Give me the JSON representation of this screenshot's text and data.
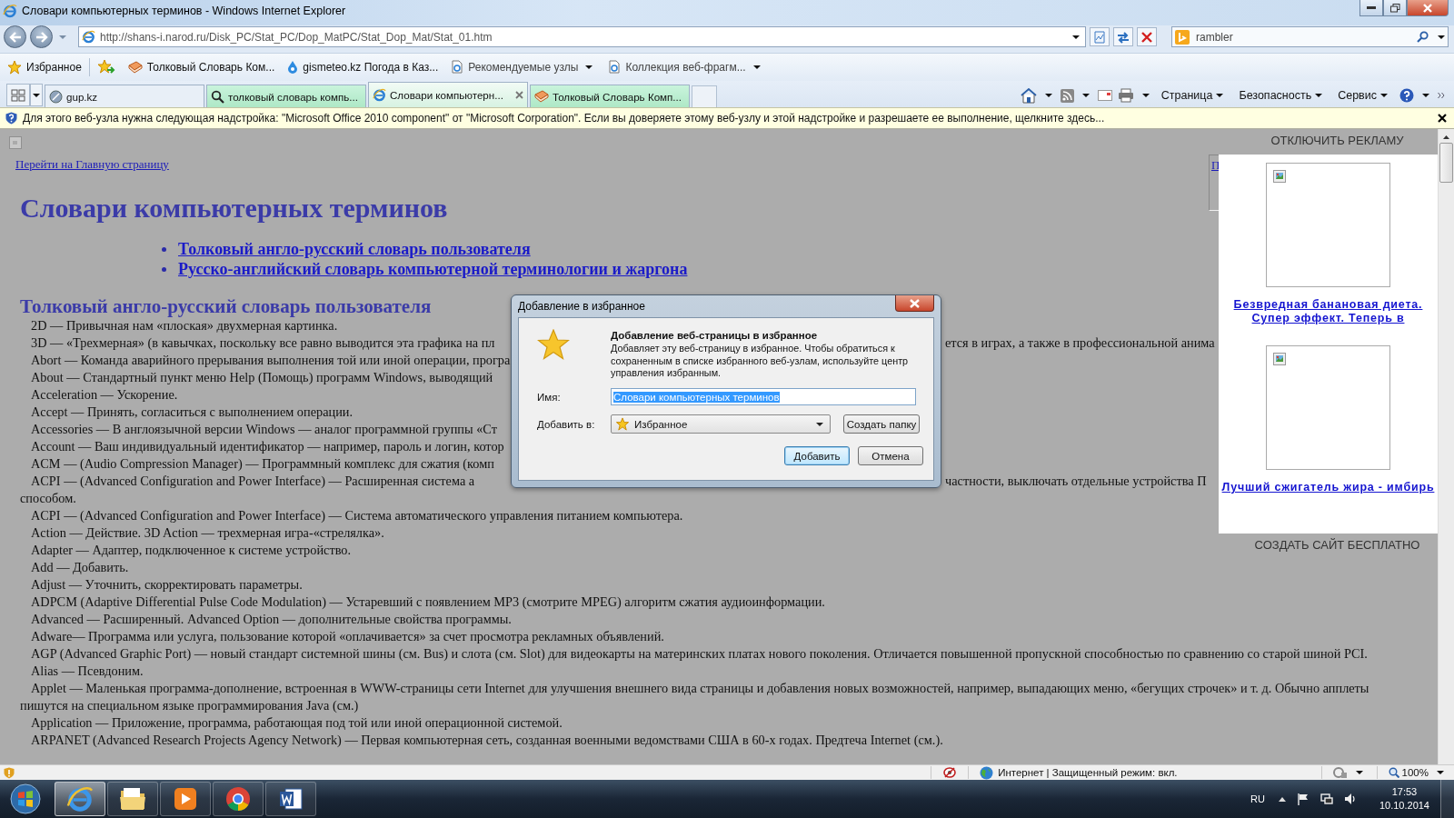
{
  "window": {
    "title": "Словари компьютерных терминов - Windows Internet Explorer"
  },
  "address_bar": {
    "url": "http://shans-i.narod.ru/Disk_PC/Stat_PC/Dop_MatPC/Stat_Dop_Mat/Stat_01.htm"
  },
  "search": {
    "value": "rambler"
  },
  "favorites_bar": {
    "favorites_label": "Избранное",
    "items": [
      {
        "label": "Толковый Словарь Ком...",
        "kind": "book",
        "menu": false
      },
      {
        "label": "gismeteo.kz Погода в Каз...",
        "kind": "drop",
        "menu": false
      },
      {
        "label": "Рекомендуемые узлы",
        "kind": "page",
        "menu": true
      },
      {
        "label": "Коллекция веб-фрагм...",
        "kind": "page",
        "menu": true
      }
    ]
  },
  "tabs": [
    {
      "label": "gup.kz",
      "kind": "site",
      "grouped": false,
      "selected": false
    },
    {
      "label": "толковый словарь компь...",
      "kind": "search",
      "grouped": true,
      "selected": false
    },
    {
      "label": "Словари компьютерн...",
      "kind": "page",
      "grouped": true,
      "selected": true
    },
    {
      "label": "Толковый Словарь Комп...",
      "kind": "book",
      "grouped": true,
      "selected": false
    }
  ],
  "command_bar": {
    "menus": [
      "Страница",
      "Безопасность",
      "Сервис"
    ]
  },
  "info_bar": {
    "text": "Для этого веб-узла нужна следующая надстройка: \"Microsoft Office 2010 component\" от \"Microsoft Corporation\". Если вы доверяете этому веб-узлу и этой надстройке и разрешаете ее выполнение, щелкните здесь..."
  },
  "page": {
    "home_link": "Перейти на Главную страницу",
    "side_link": "П",
    "title": "Словари компьютерных терминов",
    "contents": [
      "Толковый англо-русский словарь пользователя",
      "Русско-английский словарь компьютерной терминологии и жаргона"
    ],
    "section_title": "Толковый англо-русский словарь пользователя",
    "entries": [
      {
        "text": "2D — Привычная нам «плоская» двухмерная картинка."
      },
      {
        "text": "3D — «Трехмерная» (в кавычках, поскольку все равно выводится эта графика на пл",
        "text_after": "ется в играх, а также в профессиональной анима"
      },
      {
        "text": "Abort — Команда аварийного прерывания выполнения той или иной операции, програ"
      },
      {
        "text": "About — Стандартный пункт меню Help (Помощь) программ Windows, выводящий"
      },
      {
        "text": "Acceleration — Ускорение."
      },
      {
        "text": "Accept — Принять, согласиться с выполнением операции."
      },
      {
        "text": "Accessories — В англоязычной версии Windows — аналог программной группы «Ст"
      },
      {
        "text": "Account — Ваш индивидуальный идентификатор — например, пароль и логин, котор"
      },
      {
        "text": "ACM — (Audio Compression Manager) — Программный комплекс для сжатия (комп"
      },
      {
        "text": "ACPI — (Advanced Configuration and Power Interface) — Расширенная система а",
        "text_after": "частности, выключать отдельные устройства П",
        "continuation": "способом."
      },
      {
        "text": "ACPI — (Advanced Configuration and Power Interface) — Система автоматического управления питанием компьютера."
      },
      {
        "text": "Action — Действие. 3D Action — трехмерная игра-«стрелялка»."
      },
      {
        "text": "Adapter — Адаптер, подключенное к системе устройство."
      },
      {
        "text": "Add — Добавить."
      },
      {
        "text": "Adjust — Уточнить, скорректировать параметры."
      },
      {
        "text": "ADPCM (Adaptive Differential Pulse Code Modulation) — Устаревший с появлением MP3 (смотрите MPEG) алгоритм сжатия аудиоинформации."
      },
      {
        "text": "Advanced — Расширенный. Advanced Option — дополнительные свойства программы."
      },
      {
        "text": "Adware— Программа или услуга, пользование которой «оплачивается» за счет просмотра рекламных объявлений."
      },
      {
        "text": "AGP (Advanced Graphic Port) — новый стандарт системной шины (см. Bus) и слота (см. Slot) для видеокарты на материнских платах нового поколения. Отличается повышенной пропускной способностью по сравнению со старой шиной PCI."
      },
      {
        "text": "Alias — Псевдоним."
      },
      {
        "text": "Applet — Маленькая программа-дополнение, встроенная в WWW-страницы сети Internet для улучшения внешнего вида страницы и добавления новых возможностей, например, выпадающих меню, «бегущих строчек» и т. д. Обычно апплеты пишутся на специальном языке программирования Java (см.)"
      },
      {
        "text": "Application — Приложение, программа, работающая под той или иной операционной системой."
      },
      {
        "text": "ARPANET (Advanced Research Projects Agency Network) — Первая компьютерная сеть, созданная военными ведомствами США в 60-х годах. Предтеча Internet (см.)."
      }
    ]
  },
  "ad_panel": {
    "disable_label": "ОТКЛЮЧИТЬ РЕКЛАМУ",
    "ads": [
      {
        "caption_lines": [
          "Безвредная банановая диета.",
          "Супер эффект. Теперь в"
        ]
      },
      {
        "caption_lines": [
          "Лучший сжигатель жира - имбирь"
        ]
      }
    ],
    "create_site_label": "СОЗДАТЬ САЙТ БЕСПЛАТНО"
  },
  "dialog": {
    "title": "Добавление в избранное",
    "heading": "Добавление веб-страницы в избранное",
    "description": "Добавляет эту веб-страницу в избранное. Чтобы обратиться к сохраненным в списке избранного веб-узлам, используйте центр управления избранным.",
    "name_label": "Имя:",
    "name_value": "Словари компьютерных терминов",
    "name_selected": true,
    "folder_label": "Добавить в:",
    "folder_value": "Избранное",
    "new_folder_button": "Создать папку",
    "buttons": [
      {
        "label": "Добавить",
        "default": true
      },
      {
        "label": "Отмена",
        "default": false
      }
    ]
  },
  "status_bar": {
    "zone": "Интернет | Защищенный режим: вкл.",
    "zoom": "100%"
  },
  "taskbar": {
    "apps": [
      {
        "kind": "ie",
        "active": true
      },
      {
        "kind": "folder",
        "active": false
      },
      {
        "kind": "media",
        "active": false
      },
      {
        "kind": "chrome",
        "active": false
      },
      {
        "kind": "word",
        "active": false
      }
    ],
    "language": "RU",
    "time": "17:53",
    "date": "10.10.2014"
  }
}
